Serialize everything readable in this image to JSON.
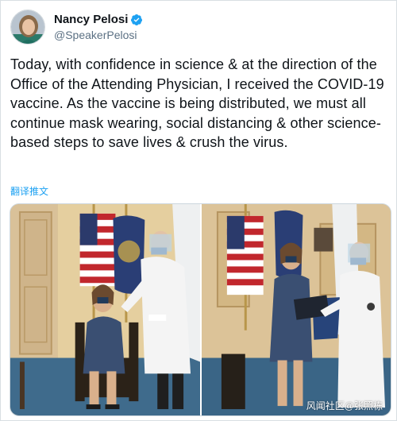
{
  "tweet": {
    "display_name": "Nancy Pelosi",
    "handle": "@SpeakerPelosi",
    "verified": true,
    "verified_icon": "verified-badge-icon",
    "text": "Today, with confidence in science & at the direction of the Office of the Attending Physician, I received the COVID-19 vaccine. As the vaccine is being distributed, we must all continue mask wearing, social distancing & other science-based steps to save lives & crush the virus.",
    "translate_label": "翻译推文"
  },
  "media": {
    "photo_count": 2
  },
  "watermark": "风闻社区@张照栋",
  "colors": {
    "accent": "#1da1f2",
    "secondary_text": "#5b7083",
    "primary_text": "#0f1419"
  }
}
